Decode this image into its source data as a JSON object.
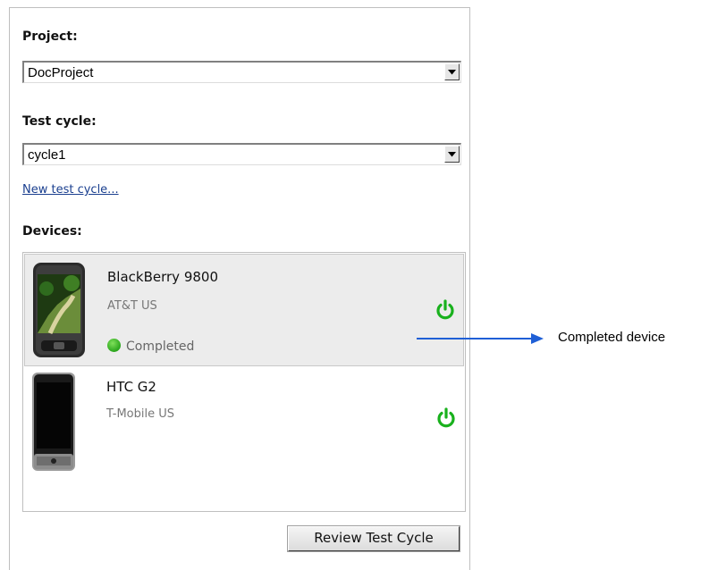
{
  "project": {
    "label": "Project:",
    "selected": "DocProject"
  },
  "test_cycle": {
    "label": "Test cycle:",
    "selected": "cycle1",
    "new_link": "New test cycle..."
  },
  "devices": {
    "label": "Devices:",
    "items": [
      {
        "name": "BlackBerry 9800",
        "carrier": "AT&T US",
        "status": "Completed",
        "selected": true,
        "power_icon": "power-icon"
      },
      {
        "name": "HTC G2",
        "carrier": "T-Mobile US",
        "status": "",
        "selected": false,
        "power_icon": "power-icon"
      }
    ]
  },
  "review_button": "Review Test Cycle",
  "annotation": {
    "text": "Completed device"
  },
  "colors": {
    "power_green": "#19b11d",
    "status_green": "#3cc12a",
    "callout_blue": "#1f5fd6",
    "link_blue": "#1a3f8f"
  }
}
